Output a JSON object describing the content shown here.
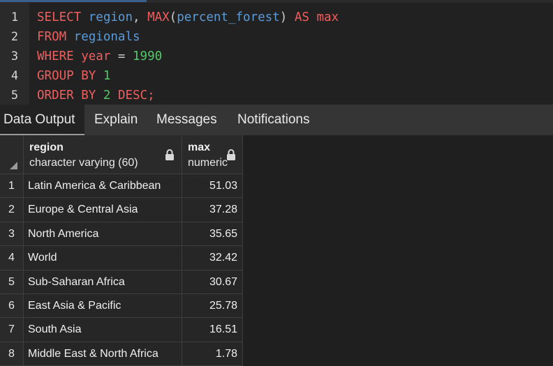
{
  "editor": {
    "lines": [
      {
        "number": "1",
        "tokens": [
          {
            "t": "SELECT",
            "c": "kw"
          },
          {
            "t": " ",
            "c": "punc"
          },
          {
            "t": "region",
            "c": "id"
          },
          {
            "t": ", ",
            "c": "punc"
          },
          {
            "t": "MAX",
            "c": "kw"
          },
          {
            "t": "(",
            "c": "punc"
          },
          {
            "t": "percent_forest",
            "c": "id"
          },
          {
            "t": ") ",
            "c": "punc"
          },
          {
            "t": "AS",
            "c": "kw"
          },
          {
            "t": " ",
            "c": "punc"
          },
          {
            "t": "max",
            "c": "kw"
          }
        ]
      },
      {
        "number": "2",
        "tokens": [
          {
            "t": "FROM",
            "c": "kw"
          },
          {
            "t": " ",
            "c": "punc"
          },
          {
            "t": "regionals",
            "c": "id"
          }
        ]
      },
      {
        "number": "3",
        "tokens": [
          {
            "t": "WHERE",
            "c": "kw"
          },
          {
            "t": " ",
            "c": "punc"
          },
          {
            "t": "year",
            "c": "kw"
          },
          {
            "t": " = ",
            "c": "op"
          },
          {
            "t": "1990",
            "c": "num"
          }
        ]
      },
      {
        "number": "4",
        "tokens": [
          {
            "t": "GROUP BY",
            "c": "kw"
          },
          {
            "t": " ",
            "c": "punc"
          },
          {
            "t": "1",
            "c": "num"
          }
        ]
      },
      {
        "number": "5",
        "tokens": [
          {
            "t": "ORDER BY",
            "c": "kw"
          },
          {
            "t": " ",
            "c": "punc"
          },
          {
            "t": "2",
            "c": "num"
          },
          {
            "t": " ",
            "c": "punc"
          },
          {
            "t": "DESC",
            "c": "kw"
          },
          {
            "t": ";",
            "c": "kw"
          }
        ]
      }
    ]
  },
  "tabs": [
    {
      "label": "Data Output",
      "active": true
    },
    {
      "label": "Explain",
      "active": false
    },
    {
      "label": "Messages",
      "active": false
    },
    {
      "label": "Notifications",
      "active": false
    }
  ],
  "grid": {
    "columns": [
      {
        "name": "region",
        "type": "character varying (60)"
      },
      {
        "name": "max",
        "type": "numeric"
      }
    ],
    "rows": [
      {
        "n": "1",
        "region": "Latin America & Caribbean",
        "max": "51.03"
      },
      {
        "n": "2",
        "region": "Europe & Central Asia",
        "max": "37.28"
      },
      {
        "n": "3",
        "region": "North America",
        "max": "35.65"
      },
      {
        "n": "4",
        "region": "World",
        "max": "32.42"
      },
      {
        "n": "5",
        "region": "Sub-Saharan Africa",
        "max": "30.67"
      },
      {
        "n": "6",
        "region": "East Asia & Pacific",
        "max": "25.78"
      },
      {
        "n": "7",
        "region": "South Asia",
        "max": "16.51"
      },
      {
        "n": "8",
        "region": "Middle East & North Africa",
        "max": "1.78"
      }
    ]
  },
  "icons": {
    "column_lock": "lock-icon",
    "select_all": "select-all-corner-icon"
  }
}
